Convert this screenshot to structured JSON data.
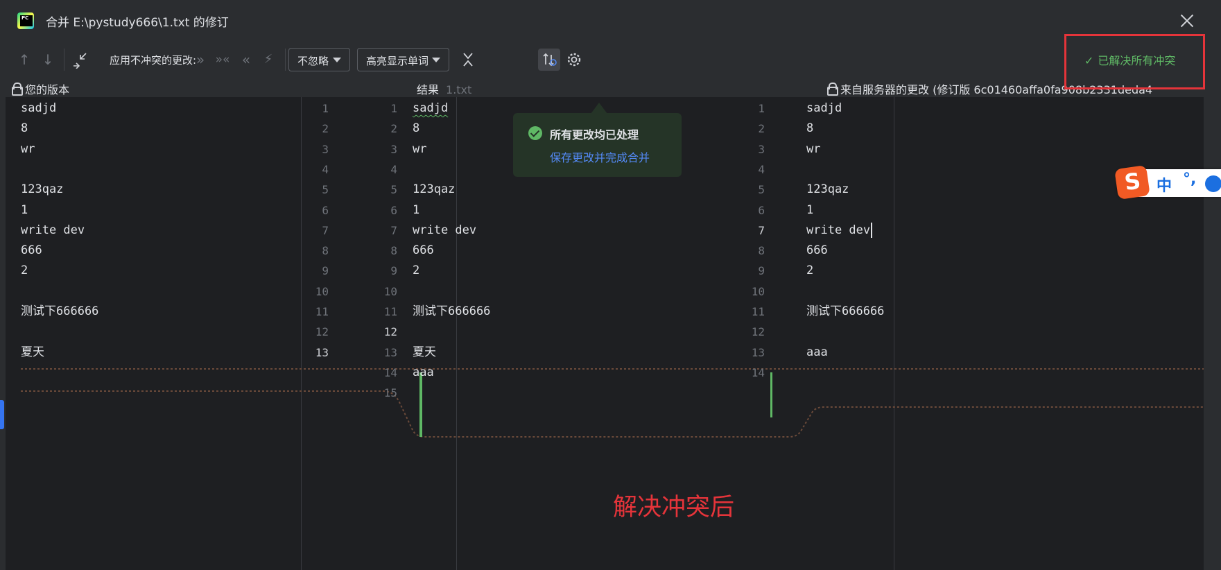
{
  "window": {
    "title": "合并 E:\\pystudy666\\1.txt 的修订",
    "app_icon": "pycharm-logo",
    "close_icon": "close-icon"
  },
  "toolbar": {
    "prev_icon": "arrow-up-icon",
    "next_icon": "arrow-down-icon",
    "apply_label": "应用不冲突的更改:",
    "ignore_dropdown": "不忽略",
    "highlight_dropdown": "高亮显示单词",
    "resolved_status": "已解决所有冲突"
  },
  "panels": {
    "left_header": "您的版本",
    "center_header": "结果",
    "center_file": "1.txt",
    "right_header": "来自服务器的更改 (修订版 6c01460affa0fa908b2331deda4"
  },
  "left_lines": [
    "sadjd",
    "8",
    "wr",
    "",
    "123qaz",
    "1",
    "write dev",
    "666",
    "2",
    "",
    "测试下666666",
    "",
    "夏天"
  ],
  "center_lines": [
    "sadjd",
    "8",
    "wr",
    "",
    "123qaz",
    "1",
    "write dev",
    "666",
    "2",
    "",
    "测试下666666",
    "",
    "夏天",
    "aaa",
    ""
  ],
  "right_lines": [
    "sadjd",
    "8",
    "wr",
    "",
    "123qaz",
    "1",
    "write dev",
    "666",
    "2",
    "",
    "测试下666666",
    "",
    "aaa",
    ""
  ],
  "notification": {
    "title": "所有更改均已处理",
    "link": "保存更改并完成合并"
  },
  "ime": {
    "zh": "中",
    "punct": "°,"
  },
  "caption": "解决冲突后",
  "colors": {
    "accent_green": "#5fb865",
    "link_blue": "#548af7",
    "annotation_red": "#e5343a"
  }
}
